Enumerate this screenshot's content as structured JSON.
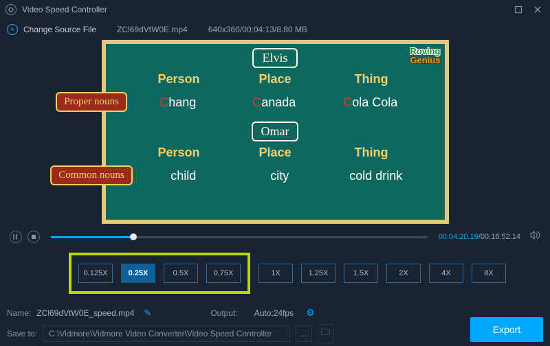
{
  "titlebar": {
    "title": "Video Speed Controller"
  },
  "toolbar": {
    "change_source_label": "Change Source File",
    "filename": "ZCl69dVtW0E.mp4",
    "fileinfo": "640x360/00:04:13/8.80 MB"
  },
  "video": {
    "logo_line1": "Roving",
    "logo_line2": "Genius",
    "name1": "Elvis",
    "name2": "Omar",
    "col1": "Person",
    "col2": "Place",
    "col3": "Thing",
    "tag1": "Proper nouns",
    "tag2": "Common nouns",
    "r1c1_r": "C",
    "r1c1": "hang",
    "r1c2_r": "C",
    "r1c2": "anada",
    "r1c3_r": "C",
    "r1c3": "ola Cola",
    "r2c1": "child",
    "r2c2": "city",
    "r2c3": "cold drink"
  },
  "playback": {
    "current": "00:04:20.19",
    "sep": "/",
    "total": "00:16:52.14"
  },
  "speeds": {
    "s1": "0.125X",
    "s2": "0.25X",
    "s3": "0.5X",
    "s4": "0.75X",
    "s5": "1X",
    "s6": "1.25X",
    "s7": "1.5X",
    "s8": "2X",
    "s9": "4X",
    "s10": "8X"
  },
  "bottom": {
    "name_label": "Name:",
    "name_value": "ZCl69dVtW0E_speed.mp4",
    "output_label": "Output:",
    "output_value": "Auto;24fps",
    "saveto_label": "Save to:",
    "saveto_value": "C:\\Vidmore\\Vidmore Video Converter\\Video Speed Controller",
    "dots": "...",
    "export_label": "Export"
  }
}
